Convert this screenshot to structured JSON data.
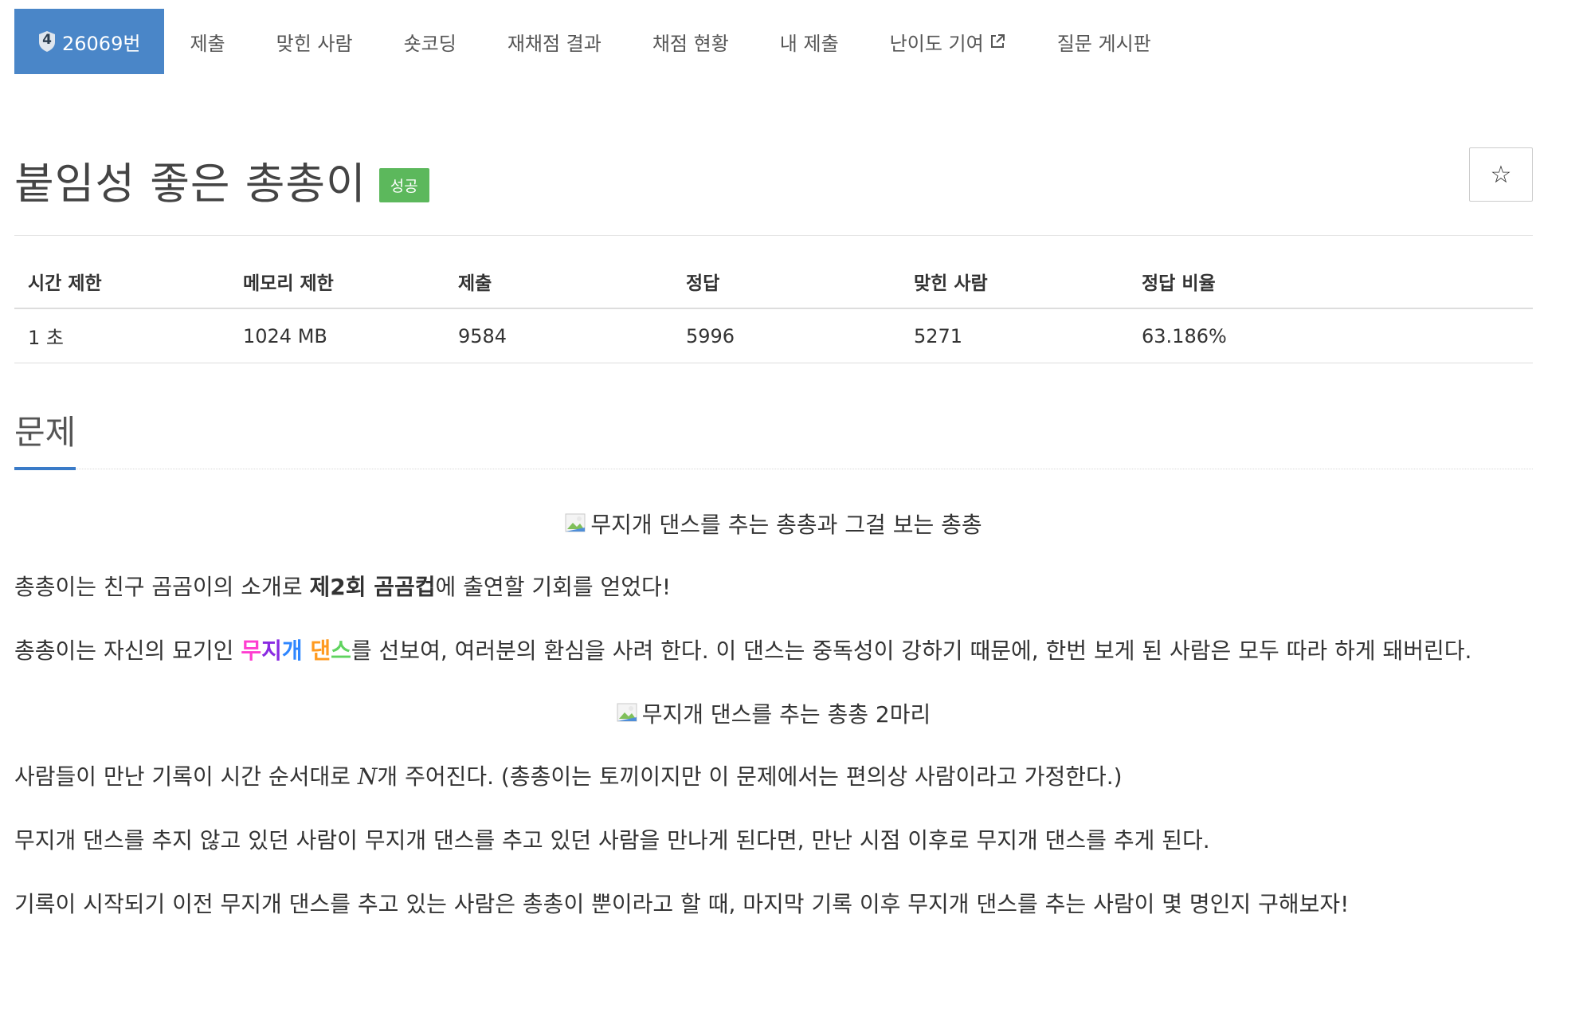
{
  "nav": {
    "tier_number": "4",
    "problem_id": "26069번",
    "items": [
      {
        "label": "제출"
      },
      {
        "label": "맞힌 사람"
      },
      {
        "label": "숏코딩"
      },
      {
        "label": "재채점 결과"
      },
      {
        "label": "채점 현황"
      },
      {
        "label": "내 제출"
      },
      {
        "label": "난이도 기여"
      },
      {
        "label": "질문 게시판"
      }
    ]
  },
  "problem": {
    "title": "붙임성 좋은 총총이",
    "status_badge": "성공",
    "star_icon": "☆"
  },
  "stats": {
    "headers": [
      "시간 제한",
      "메모리 제한",
      "제출",
      "정답",
      "맞힌 사람",
      "정답 비율"
    ],
    "values": [
      "1 초",
      "1024 MB",
      "9584",
      "5996",
      "5271",
      "63.186%"
    ]
  },
  "section": {
    "title": "문제"
  },
  "body": {
    "img1_alt": "무지개 댄스를 추는 총총과 그걸 보는 총총",
    "p1_before": "총총이는 친구 곰곰이의 소개로 ",
    "p1_bold": "제2회 곰곰컵",
    "p1_after": "에 출연할 기회를 얻었다!",
    "p2_before": "총총이는 자신의 묘기인 ",
    "rainbow": [
      {
        "char": "무",
        "color": "#ff3dd0"
      },
      {
        "char": "지",
        "color": "#8a2be2"
      },
      {
        "char": "개",
        "color": "#2e86ff"
      },
      {
        "char": " ",
        "color": "#333333"
      },
      {
        "char": "댄",
        "color": "#ff9a1f"
      },
      {
        "char": "스",
        "color": "#5fd35f"
      }
    ],
    "p2_after": "를 선보여, 여러분의 환심을 사려 한다. 이 댄스는 중독성이 강하기 때문에, 한번 보게 된 사람은 모두 따라 하게 돼버린다.",
    "img2_alt": "무지개 댄스를 추는 총총 2마리",
    "p3_before": "사람들이 만난 기록이 시간 순서대로 ",
    "p3_math": "N",
    "p3_after": "개 주어진다. (총총이는 토끼이지만 이 문제에서는 편의상 사람이라고 가정한다.)",
    "p4": "무지개 댄스를 추지 않고 있던 사람이 무지개 댄스를 추고 있던 사람을 만나게 된다면, 만난 시점 이후로 무지개 댄스를 추게 된다.",
    "p5": "기록이 시작되기 이전 무지개 댄스를 추고 있는 사람은 총총이 뿐이라고 할 때, 마지막 기록 이후 무지개 댄스를 추는 사람이 몇 명인지 구해보자!"
  }
}
